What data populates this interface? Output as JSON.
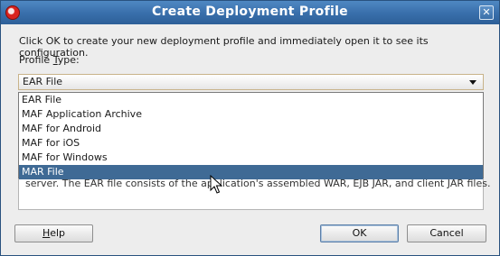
{
  "window": {
    "title": "Create Deployment Profile",
    "close_glyph": "✕"
  },
  "message": "Click OK to create your new deployment profile and immediately open it to see its configuration.",
  "profile_type": {
    "label_prefix": "Profile ",
    "label_mnemonic": "T",
    "label_suffix": "ype:",
    "selected_value": "EAR File",
    "options": [
      "EAR File",
      "MAF Application Archive",
      "MAF for Android",
      "MAF for iOS",
      "MAF for Windows",
      "MAR File"
    ],
    "highlighted_option": "MAR File"
  },
  "description": "server.  The EAR file consists of the application's assembled WAR, EJB JAR, and client JAR files.",
  "buttons": {
    "help_mnemonic": "H",
    "help_rest": "elp",
    "ok": "OK",
    "cancel": "Cancel"
  },
  "colors": {
    "title_bar": "#3a70ac",
    "selection": "#3f6a95"
  },
  "icons": {
    "app": "oracle-app-icon",
    "close": "close-icon",
    "combo": "chevron-down-icon",
    "pointer": "mouse-cursor-icon"
  }
}
